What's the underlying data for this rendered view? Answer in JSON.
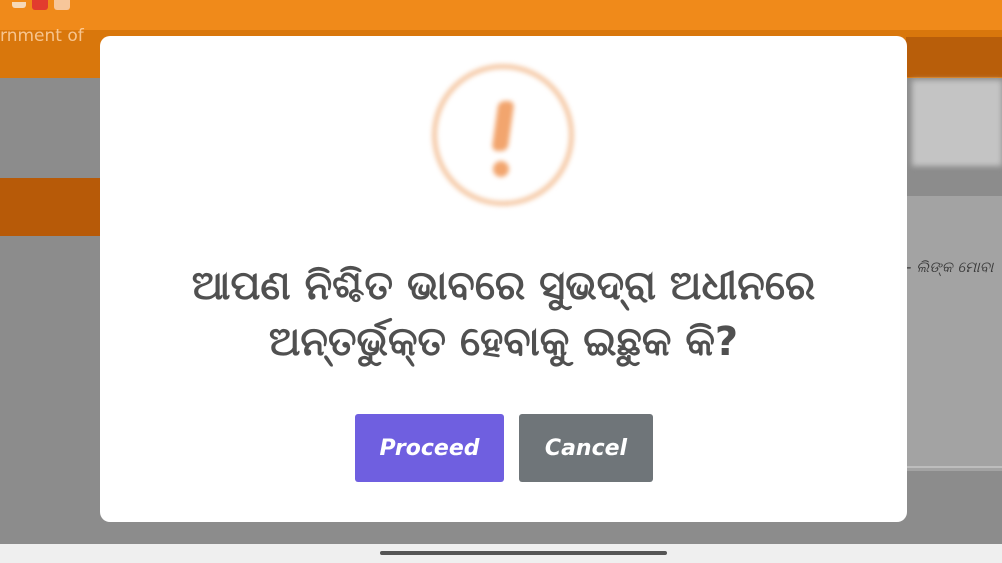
{
  "background": {
    "header_text": "rnment of",
    "right_text": "- ଲିଙ୍କ ମୋବା"
  },
  "dialog": {
    "icon": "warning-exclamation-icon",
    "message_line1": "ଆପଣ ନିଶ୍ଚିତ ଭାବରେ ସୁଭଦ୍ରା ଅଧୀନରେ",
    "message_line2": "ଅନ୍ତର୍ଭୁକ୍ତ ହେବାକୁ ଇଛୁକ କି?",
    "proceed_label": "Proceed",
    "cancel_label": "Cancel"
  },
  "colors": {
    "brand_orange": "#d9770c",
    "proceed": "#6f5fe0",
    "cancel": "#6f7579",
    "warning": "#f2a56e"
  }
}
